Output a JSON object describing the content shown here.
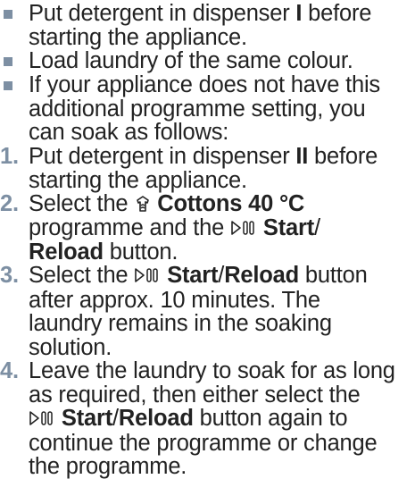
{
  "bullets": [
    {
      "line1_a": "Put detergent in dispenser ",
      "line1_b": "I",
      "line1_c": " before",
      "line2": "starting the appliance."
    },
    {
      "line1": "Load laundry of the same colour."
    },
    {
      "line1": "If your appliance does not have this",
      "line2": "additional programme setting, you",
      "line3": "can soak as follows:"
    }
  ],
  "steps": [
    {
      "number": "1.",
      "line1_a": "Put detergent in dispenser ",
      "line1_b": "II",
      "line1_c": " before",
      "line2": "starting the appliance."
    },
    {
      "number": "2.",
      "line1_a": "Select the ",
      "line1_icon": "cottons-programme-icon",
      "line1_b": "Cottons 40 °C",
      "line2_a": "programme and the ",
      "line2_icon": "start-reload-icon",
      "line2_b": "Start",
      "line2_c": "/",
      "line3": "Reload",
      "line3_b": " button."
    },
    {
      "number": "3.",
      "line1_a": "Select the ",
      "line1_icon": "start-reload-icon",
      "line1_b": "Start",
      "line1_c": "/",
      "line1_d": "Reload",
      "line1_e": " button",
      "line2": "after approx. 10 minutes. The",
      "line3": "laundry remains in the soaking",
      "line4": "solution."
    },
    {
      "number": "4.",
      "line1": "Leave the laundry to soak for as long",
      "line2": "as required, then either select the",
      "line3_icon": "start-reload-icon",
      "line3_a": "Start",
      "line3_b": "/",
      "line3_c": "Reload",
      "line3_d": " button again to",
      "line4": "continue the programme or change",
      "line5": "the programme."
    }
  ],
  "colors": {
    "accent": "#7d8fa3",
    "text": "#222222"
  }
}
